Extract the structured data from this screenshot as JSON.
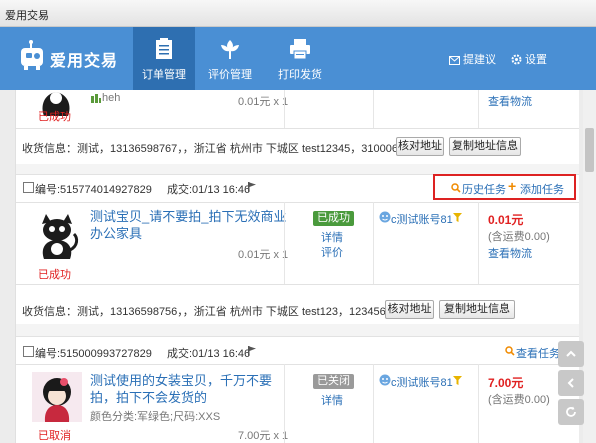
{
  "window": {
    "title": "爱用交易"
  },
  "brand": {
    "name": "爱用交易"
  },
  "nav": [
    {
      "label": "订单管理",
      "icon": "clipboard-icon",
      "active": true
    },
    {
      "label": "评价管理",
      "icon": "flower-icon",
      "active": false
    },
    {
      "label": "打印发货",
      "icon": "printer-icon",
      "active": false
    }
  ],
  "header_links": {
    "suggest": "提建议",
    "settings": "设置"
  },
  "order0": {
    "member": "heh",
    "price": "0.01元 x 1",
    "status": "已成功",
    "logistics": "查看物流",
    "ship_info": "收货信息：测试，13136598767，，浙江省 杭州市 下城区 test12345，310006",
    "btn_verify": "核对地址",
    "btn_copy": "复制地址信息"
  },
  "order1": {
    "number": "编号:515774014927829",
    "deal_time": "成交:01/13 16:46",
    "history_task": "历史任务",
    "add_task": "添加任务",
    "title": "测试宝贝_请不要拍_拍下无效商业办公家具",
    "price": "0.01元 x 1",
    "trade_status": "已成功",
    "status_badge": "已成功",
    "detail": "详情",
    "review": "评价",
    "buyer": "c测试账号81",
    "total": "0.01元",
    "shipping": "(含运费0.00)",
    "logistics": "查看物流",
    "ship_info": "收货信息：测试，13136598756，，浙江省 杭州市 下城区 test123，123456",
    "btn_verify": "核对地址",
    "btn_copy": "复制地址信息"
  },
  "order2": {
    "number": "编号:515000993727829",
    "deal_time": "成交:01/13 16:46",
    "view_task": "查看任务",
    "title": "测试使用的女装宝贝，千万不要拍，拍下不会发货的",
    "sku": "颜色分类:军绿色;尺码:XXS",
    "price": "7.00元 x 1",
    "trade_status": "已取消",
    "status_badge": "已关闭",
    "detail": "详情",
    "buyer": "c测试账号81",
    "total": "7.00元",
    "shipping": "(含运费0.00)"
  },
  "colors": {
    "header": "#4a8fd4",
    "nav_active": "#2e6fb1",
    "link": "#2a6fb6",
    "price_red": "#e02020",
    "badge_green": "#4a9a3c",
    "badge_gray": "#9a9a9a",
    "orange": "#f08a00"
  }
}
